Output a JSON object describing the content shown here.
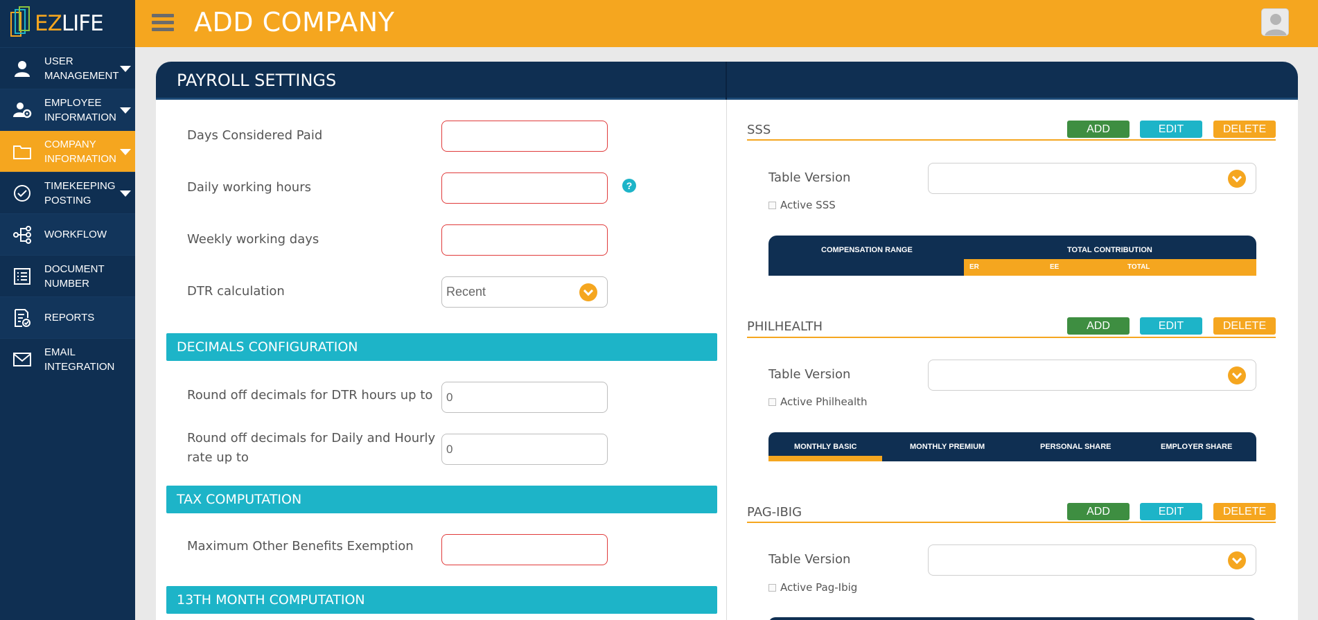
{
  "app": {
    "logo_ez": "EZ",
    "logo_life": "LIFE"
  },
  "sidebar": {
    "items": [
      {
        "label": "USER MANAGEMENT",
        "icon": "user-icon"
      },
      {
        "label": "EMPLOYEE INFORMATION",
        "icon": "user-gear-icon"
      },
      {
        "label": "COMPANY INFORMATION",
        "icon": "folder-icon"
      },
      {
        "label": "TIMEKEEPING POSTING",
        "icon": "check-circle-icon"
      },
      {
        "label": "WORKFLOW",
        "icon": "workflow-icon"
      },
      {
        "label": "DOCUMENT NUMBER",
        "icon": "list-icon"
      },
      {
        "label": "REPORTS",
        "icon": "report-icon"
      },
      {
        "label": "EMAIL INTEGRATION",
        "icon": "mail-icon"
      }
    ]
  },
  "header": {
    "title": "ADD COMPANY"
  },
  "card": {
    "title": "PAYROLL SETTINGS"
  },
  "form": {
    "days_paid": "Days Considered Paid",
    "daily_hours": "Daily working hours",
    "weekly_days": "Weekly working days",
    "dtr_calc": "DTR calculation",
    "dtr_value": "Recent",
    "help": "?"
  },
  "decimals": {
    "title": "DECIMALS CONFIGURATION",
    "dtr_label": "Round off decimals for DTR hours up to",
    "dtr_value": "0",
    "rate_label_1": "Round off decimals for Daily and Hourly",
    "rate_label_2": "rate up to",
    "rate_value": "0"
  },
  "tax": {
    "title": "TAX COMPUTATION",
    "max_label": "Maximum Other Benefits Exemption"
  },
  "thirteenth": {
    "title": "13TH MONTH COMPUTATION"
  },
  "buttons": {
    "add": "ADD",
    "edit": "EDIT",
    "delete": "DELETE"
  },
  "sss": {
    "title": "SSS",
    "table_version": "Table Version",
    "active": "Active SSS",
    "col_range": "COMPENSATION RANGE",
    "col_total": "TOTAL CONTRIBUTION",
    "sub_er": "ER",
    "sub_ee": "EE",
    "sub_total": "TOTAL"
  },
  "philhealth": {
    "title": "PHILHEALTH",
    "table_version": "Table Version",
    "active": "Active Philhealth",
    "cols": [
      "MONTHLY BASIC",
      "MONTHLY PREMIUM",
      "PERSONAL SHARE",
      "EMPLOYER SHARE"
    ]
  },
  "pagibig": {
    "title": "PAG-IBIG",
    "table_version": "Table Version",
    "active": "Active Pag-Ibig"
  },
  "colors": {
    "navy": "#0f2f52",
    "orange": "#f5a61f",
    "teal": "#1db4c8",
    "green": "#3e8e41",
    "error": "#e03a3a"
  }
}
